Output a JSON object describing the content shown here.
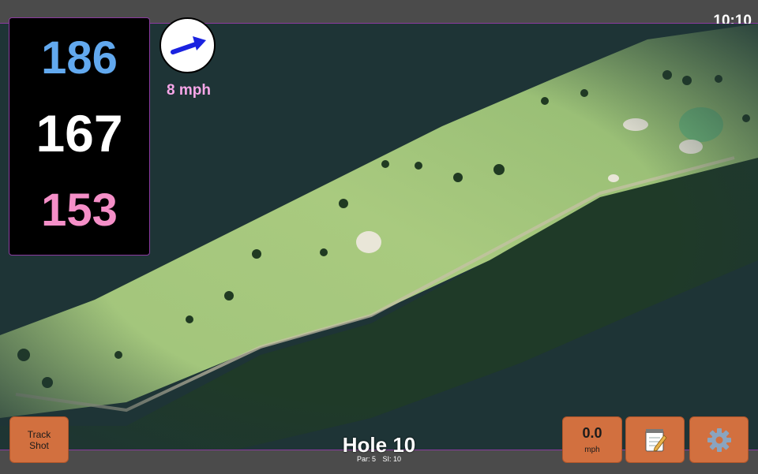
{
  "clock": "10:10",
  "distances": {
    "back": "186",
    "center": "167",
    "front": "153"
  },
  "wind": {
    "speed_label": "8 mph",
    "direction_icon": "arrow-icon"
  },
  "hole": {
    "title": "Hole 10",
    "par_label": "Par: 5",
    "si_label": "SI: 10"
  },
  "buttons": {
    "track_shot": "Track Shot",
    "speed_value": "0.0",
    "speed_unit": "mph",
    "notes_icon": "notepad-icon",
    "settings_icon": "gear-icon"
  },
  "colors": {
    "back": "#62a9ef",
    "center": "#ffffff",
    "front": "#f58fc8",
    "wind_text": "#f7a6e8",
    "button": "#d2703f",
    "accent": "#8b3aa0"
  }
}
